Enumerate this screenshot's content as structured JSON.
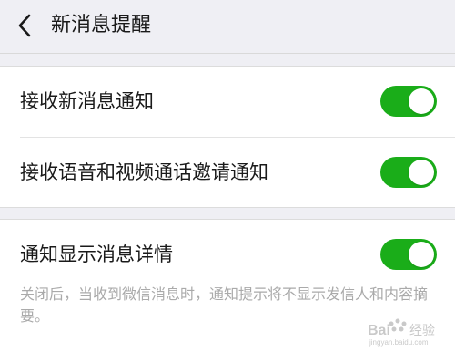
{
  "header": {
    "title": "新消息提醒",
    "back_icon": "back-arrow-icon"
  },
  "settings": {
    "receive_new_messages": {
      "label": "接收新消息通知",
      "enabled": true
    },
    "voice_video_invites": {
      "label": "接收语音和视频通话邀请通知",
      "enabled": true
    },
    "show_message_details": {
      "label": "通知显示消息详情",
      "enabled": true,
      "description": "关闭后，当收到微信消息时，通知提示将不显示发信人和内容摘要。"
    }
  },
  "watermark": {
    "text": "Bai 经验",
    "subtext": "jingyan.baidu.com"
  },
  "colors": {
    "toggle_on": "#1aad19",
    "background": "#efeff4",
    "card": "#ffffff",
    "text": "#1a1a1a",
    "desc_text": "#aaaaaa"
  }
}
